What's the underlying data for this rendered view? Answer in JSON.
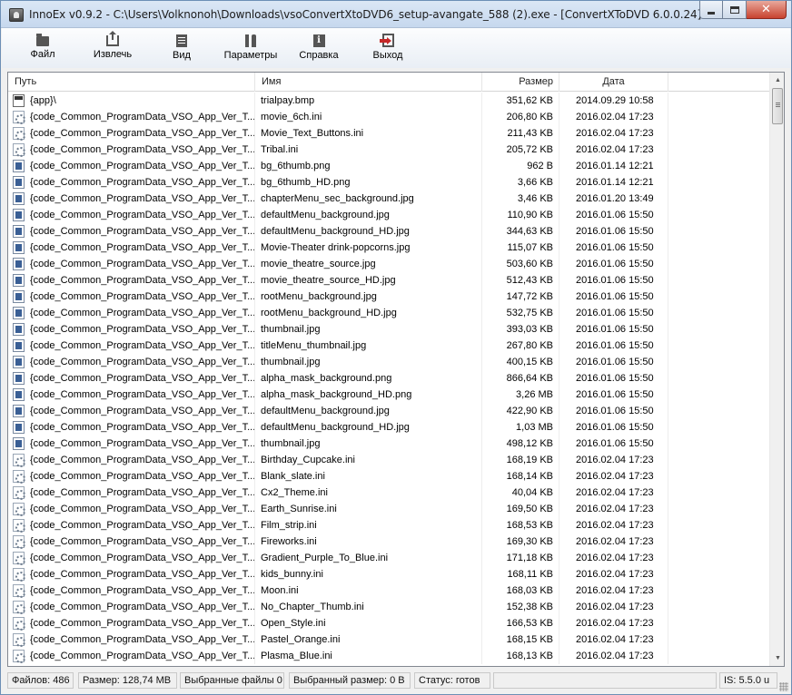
{
  "window": {
    "title": "InnoEx v0.9.2 - C:\\Users\\Volknonoh\\Downloads\\vsoConvertXtoDVD6_setup-avangate_588 (2).exe - [ConvertXToDVD 6.0.0.24]"
  },
  "toolbar": {
    "file_label": "Файл",
    "extract_label": "Извлечь",
    "view_label": "Вид",
    "params_label": "Параметры",
    "help_label": "Справка",
    "exit_label": "Выход"
  },
  "table": {
    "columns": [
      "Путь",
      "Имя",
      "Размер",
      "Дата"
    ],
    "rows": [
      {
        "icon": "bmp",
        "path": "{app}\\",
        "name": "trialpay.bmp",
        "size": "351,62 KB",
        "date": "2014.09.29 10:58"
      },
      {
        "icon": "ini",
        "path": "{code_Common_ProgramData_VSO_App_Ver_T...",
        "name": "movie_6ch.ini",
        "size": "206,80 KB",
        "date": "2016.02.04 17:23"
      },
      {
        "icon": "ini",
        "path": "{code_Common_ProgramData_VSO_App_Ver_T...",
        "name": "Movie_Text_Buttons.ini",
        "size": "211,43 KB",
        "date": "2016.02.04 17:23"
      },
      {
        "icon": "ini",
        "path": "{code_Common_ProgramData_VSO_App_Ver_T...",
        "name": "Tribal.ini",
        "size": "205,72 KB",
        "date": "2016.02.04 17:23"
      },
      {
        "icon": "img",
        "path": "{code_Common_ProgramData_VSO_App_Ver_T...",
        "name": "bg_6thumb.png",
        "size": "962 B",
        "date": "2016.01.14 12:21"
      },
      {
        "icon": "img",
        "path": "{code_Common_ProgramData_VSO_App_Ver_T...",
        "name": "bg_6thumb_HD.png",
        "size": "3,66 KB",
        "date": "2016.01.14 12:21"
      },
      {
        "icon": "img",
        "path": "{code_Common_ProgramData_VSO_App_Ver_T...",
        "name": "chapterMenu_sec_background.jpg",
        "size": "3,46 KB",
        "date": "2016.01.20 13:49"
      },
      {
        "icon": "img",
        "path": "{code_Common_ProgramData_VSO_App_Ver_T...",
        "name": "defaultMenu_background.jpg",
        "size": "110,90 KB",
        "date": "2016.01.06 15:50"
      },
      {
        "icon": "img",
        "path": "{code_Common_ProgramData_VSO_App_Ver_T...",
        "name": "defaultMenu_background_HD.jpg",
        "size": "344,63 KB",
        "date": "2016.01.06 15:50"
      },
      {
        "icon": "img",
        "path": "{code_Common_ProgramData_VSO_App_Ver_T...",
        "name": "Movie-Theater drink-popcorns.jpg",
        "size": "115,07 KB",
        "date": "2016.01.06 15:50"
      },
      {
        "icon": "img",
        "path": "{code_Common_ProgramData_VSO_App_Ver_T...",
        "name": "movie_theatre_source.jpg",
        "size": "503,60 KB",
        "date": "2016.01.06 15:50"
      },
      {
        "icon": "img",
        "path": "{code_Common_ProgramData_VSO_App_Ver_T...",
        "name": "movie_theatre_source_HD.jpg",
        "size": "512,43 KB",
        "date": "2016.01.06 15:50"
      },
      {
        "icon": "img",
        "path": "{code_Common_ProgramData_VSO_App_Ver_T...",
        "name": "rootMenu_background.jpg",
        "size": "147,72 KB",
        "date": "2016.01.06 15:50"
      },
      {
        "icon": "img",
        "path": "{code_Common_ProgramData_VSO_App_Ver_T...",
        "name": "rootMenu_background_HD.jpg",
        "size": "532,75 KB",
        "date": "2016.01.06 15:50"
      },
      {
        "icon": "img",
        "path": "{code_Common_ProgramData_VSO_App_Ver_T...",
        "name": "thumbnail.jpg",
        "size": "393,03 KB",
        "date": "2016.01.06 15:50"
      },
      {
        "icon": "img",
        "path": "{code_Common_ProgramData_VSO_App_Ver_T...",
        "name": "titleMenu_thumbnail.jpg",
        "size": "267,80 KB",
        "date": "2016.01.06 15:50"
      },
      {
        "icon": "img",
        "path": "{code_Common_ProgramData_VSO_App_Ver_T...",
        "name": "thumbnail.jpg",
        "size": "400,15 KB",
        "date": "2016.01.06 15:50"
      },
      {
        "icon": "img",
        "path": "{code_Common_ProgramData_VSO_App_Ver_T...",
        "name": "alpha_mask_background.png",
        "size": "866,64 KB",
        "date": "2016.01.06 15:50"
      },
      {
        "icon": "img",
        "path": "{code_Common_ProgramData_VSO_App_Ver_T...",
        "name": "alpha_mask_background_HD.png",
        "size": "3,26 MB",
        "date": "2016.01.06 15:50"
      },
      {
        "icon": "img",
        "path": "{code_Common_ProgramData_VSO_App_Ver_T...",
        "name": "defaultMenu_background.jpg",
        "size": "422,90 KB",
        "date": "2016.01.06 15:50"
      },
      {
        "icon": "img",
        "path": "{code_Common_ProgramData_VSO_App_Ver_T...",
        "name": "defaultMenu_background_HD.jpg",
        "size": "1,03 MB",
        "date": "2016.01.06 15:50"
      },
      {
        "icon": "img",
        "path": "{code_Common_ProgramData_VSO_App_Ver_T...",
        "name": "thumbnail.jpg",
        "size": "498,12 KB",
        "date": "2016.01.06 15:50"
      },
      {
        "icon": "ini",
        "path": "{code_Common_ProgramData_VSO_App_Ver_T...",
        "name": "Birthday_Cupcake.ini",
        "size": "168,19 KB",
        "date": "2016.02.04 17:23"
      },
      {
        "icon": "ini",
        "path": "{code_Common_ProgramData_VSO_App_Ver_T...",
        "name": "Blank_slate.ini",
        "size": "168,14 KB",
        "date": "2016.02.04 17:23"
      },
      {
        "icon": "ini",
        "path": "{code_Common_ProgramData_VSO_App_Ver_T...",
        "name": "Cx2_Theme.ini",
        "size": "40,04 KB",
        "date": "2016.02.04 17:23"
      },
      {
        "icon": "ini",
        "path": "{code_Common_ProgramData_VSO_App_Ver_T...",
        "name": "Earth_Sunrise.ini",
        "size": "169,50 KB",
        "date": "2016.02.04 17:23"
      },
      {
        "icon": "ini",
        "path": "{code_Common_ProgramData_VSO_App_Ver_T...",
        "name": "Film_strip.ini",
        "size": "168,53 KB",
        "date": "2016.02.04 17:23"
      },
      {
        "icon": "ini",
        "path": "{code_Common_ProgramData_VSO_App_Ver_T...",
        "name": "Fireworks.ini",
        "size": "169,30 KB",
        "date": "2016.02.04 17:23"
      },
      {
        "icon": "ini",
        "path": "{code_Common_ProgramData_VSO_App_Ver_T...",
        "name": "Gradient_Purple_To_Blue.ini",
        "size": "171,18 KB",
        "date": "2016.02.04 17:23"
      },
      {
        "icon": "ini",
        "path": "{code_Common_ProgramData_VSO_App_Ver_T...",
        "name": "kids_bunny.ini",
        "size": "168,11 KB",
        "date": "2016.02.04 17:23"
      },
      {
        "icon": "ini",
        "path": "{code_Common_ProgramData_VSO_App_Ver_T...",
        "name": "Moon.ini",
        "size": "168,03 KB",
        "date": "2016.02.04 17:23"
      },
      {
        "icon": "ini",
        "path": "{code_Common_ProgramData_VSO_App_Ver_T...",
        "name": "No_Chapter_Thumb.ini",
        "size": "152,38 KB",
        "date": "2016.02.04 17:23"
      },
      {
        "icon": "ini",
        "path": "{code_Common_ProgramData_VSO_App_Ver_T...",
        "name": "Open_Style.ini",
        "size": "166,53 KB",
        "date": "2016.02.04 17:23"
      },
      {
        "icon": "ini",
        "path": "{code_Common_ProgramData_VSO_App_Ver_T...",
        "name": "Pastel_Orange.ini",
        "size": "168,15 KB",
        "date": "2016.02.04 17:23"
      },
      {
        "icon": "ini",
        "path": "{code_Common_ProgramData_VSO_App_Ver_T...",
        "name": "Plasma_Blue.ini",
        "size": "168,13 KB",
        "date": "2016.02.04 17:23"
      }
    ]
  },
  "statusbar": {
    "files": "Файлов: 486",
    "size": "Размер: 128,74 MB",
    "selected_files": "Выбранные файлы 0",
    "selected_size": "Выбранный размер: 0 B",
    "status": "Статус: готов",
    "is_version": "IS: 5.5.0 u"
  },
  "colors": {
    "titlebar": "#c6d8ee",
    "close_button": "#c8422f",
    "list_background": "#ffffff"
  }
}
